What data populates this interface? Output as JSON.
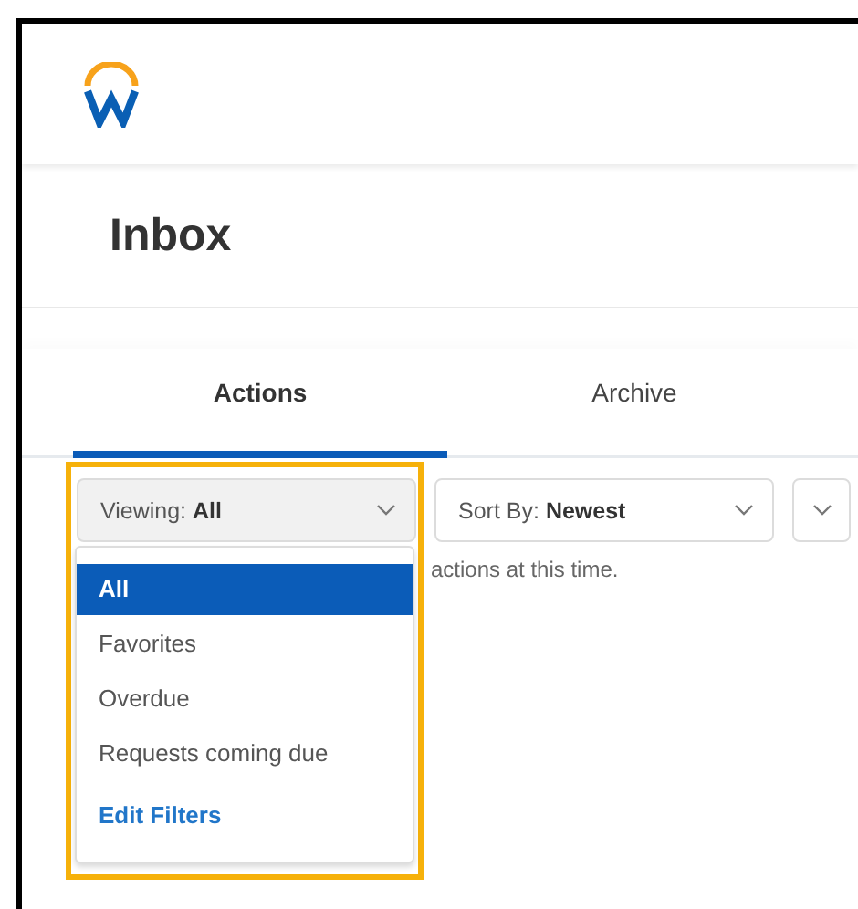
{
  "page": {
    "title": "Inbox"
  },
  "tabs": [
    {
      "label": "Actions",
      "selected": true
    },
    {
      "label": "Archive",
      "selected": false
    }
  ],
  "filters": {
    "viewing": {
      "label": "Viewing: **All**",
      "expanded": true,
      "highlighted": true
    },
    "sort": {
      "label": "Sort By: **Newest**"
    }
  },
  "message": "actions at this time.",
  "view_menu": {
    "items": [
      {
        "label": "All",
        "selected": true
      },
      {
        "label": "Favorites",
        "selected": false
      },
      {
        "label": "Overdue",
        "selected": false
      },
      {
        "label": "Requests coming due",
        "selected": false
      }
    ],
    "link": "Edit Filters"
  }
}
